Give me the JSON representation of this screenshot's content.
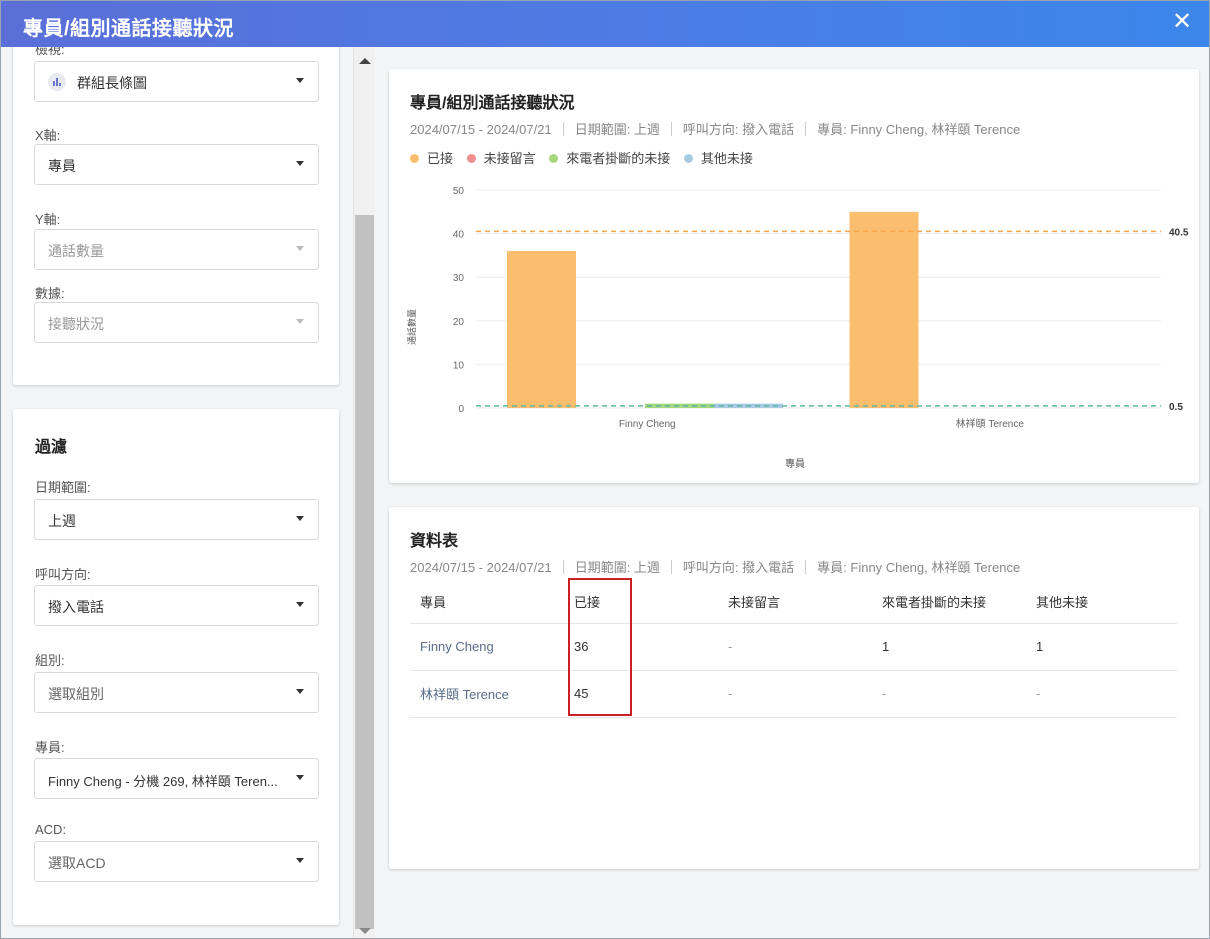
{
  "window": {
    "title": "專員/組別通話接聽狀況",
    "close_icon": "close-icon"
  },
  "settings": {
    "view_label": "檢視:",
    "view_value": "群組長條圖",
    "x_label": "X軸:",
    "x_value": "專員",
    "y_label": "Y軸:",
    "y_value": "通話數量",
    "data_label": "數據:",
    "data_value": "接聽狀況"
  },
  "filter": {
    "heading": "過濾",
    "date_label": "日期範圍:",
    "date_value": "上週",
    "direction_label": "呼叫方向:",
    "direction_value": "撥入電話",
    "group_label": "組別:",
    "group_value": "選取組別",
    "agent_label": "專員:",
    "agent_value": "Finny Cheng - 分機 269, 林祥頤 Teren...",
    "acd_label": "ACD:",
    "acd_value": "選取ACD"
  },
  "chart_card": {
    "title": "專員/組別通話接聽狀況",
    "meta": [
      "2024/07/15 - 2024/07/21",
      "日期範圍: 上週",
      "呼叫方向: 撥入電話",
      "專員: Finny Cheng, 林祥頤 Terence"
    ]
  },
  "chart_data": {
    "type": "bar",
    "categories": [
      "Finny Cheng",
      "林祥頤 Terence"
    ],
    "series": [
      {
        "name": "已接",
        "color": "#fbbd6e",
        "values": [
          36,
          45
        ]
      },
      {
        "name": "未接留言",
        "color": "#f08d8d",
        "values": [
          0,
          0
        ]
      },
      {
        "name": "來電者掛斷的未接",
        "color": "#a5d77f",
        "values": [
          1,
          0
        ]
      },
      {
        "name": "其他未接",
        "color": "#a8cbe3",
        "values": [
          1,
          0
        ]
      }
    ],
    "xlabel": "專員",
    "ylabel": "通話數量",
    "ylim": [
      0,
      50
    ],
    "yticks": [
      "0",
      "10",
      "20",
      "30",
      "40",
      "50"
    ],
    "reference_lines": [
      {
        "value": 40.5,
        "label": "40.5",
        "color": "#f5a54a"
      },
      {
        "value": 0.5,
        "label": "0.5",
        "color": "#5fb6a3"
      }
    ],
    "grid": true,
    "legend_position": "top-left"
  },
  "table_card": {
    "title": "資料表",
    "meta": [
      "2024/07/15 - 2024/07/21",
      "日期範圍: 上週",
      "呼叫方向: 撥入電話",
      "專員: Finny Cheng, 林祥頤 Terence"
    ],
    "headers": [
      "專員",
      "已接",
      "未接留言",
      "來電者掛斷的未接",
      "其他未接"
    ],
    "rows": [
      [
        "Finny Cheng",
        "36",
        "-",
        "1",
        "1"
      ],
      [
        "林祥頤 Terence",
        "45",
        "-",
        "-",
        "-"
      ]
    ]
  }
}
